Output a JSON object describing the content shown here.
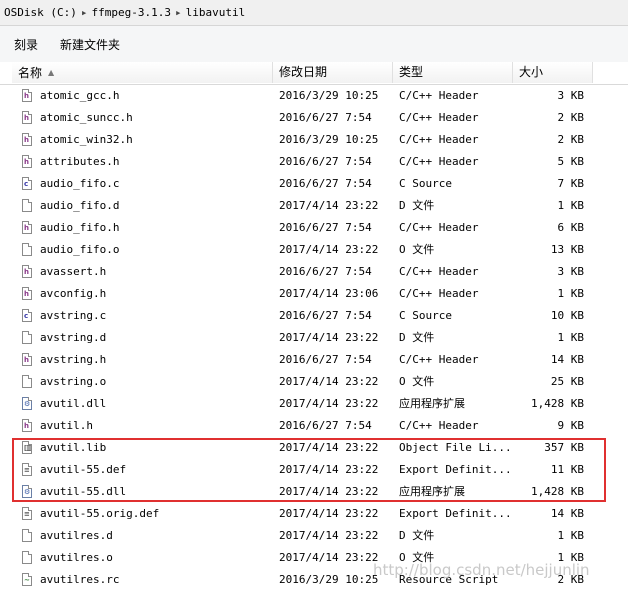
{
  "breadcrumb": [
    "OSDisk (C:)",
    "ffmpeg-3.1.3",
    "libavutil"
  ],
  "breadcrumb_separator": "▸",
  "toolbar": {
    "burn_label": "刻录",
    "new_folder_label": "新建文件夹"
  },
  "columns": {
    "name": "名称",
    "date": "修改日期",
    "type": "类型",
    "size": "大小"
  },
  "sort": {
    "column": "name",
    "direction": "ascending",
    "indicator": "▲"
  },
  "files": [
    {
      "name": "atomic_gcc.h",
      "date": "2016/3/29 10:25",
      "type": "C/C++ Header",
      "size": "3 KB",
      "icon": "h-header-icon",
      "glyph": "h",
      "kind": "h"
    },
    {
      "name": "atomic_suncc.h",
      "date": "2016/6/27 7:54",
      "type": "C/C++ Header",
      "size": "2 KB",
      "icon": "h-header-icon",
      "glyph": "h",
      "kind": "h"
    },
    {
      "name": "atomic_win32.h",
      "date": "2016/3/29 10:25",
      "type": "C/C++ Header",
      "size": "2 KB",
      "icon": "h-header-icon",
      "glyph": "h",
      "kind": "h"
    },
    {
      "name": "attributes.h",
      "date": "2016/6/27 7:54",
      "type": "C/C++ Header",
      "size": "5 KB",
      "icon": "h-header-icon",
      "glyph": "h",
      "kind": "h"
    },
    {
      "name": "audio_fifo.c",
      "date": "2016/6/27 7:54",
      "type": "C Source",
      "size": "7 KB",
      "icon": "c-source-icon",
      "glyph": "c",
      "kind": "c"
    },
    {
      "name": "audio_fifo.d",
      "date": "2017/4/14 23:22",
      "type": "D 文件",
      "size": "1 KB",
      "icon": "blank-file-icon",
      "glyph": "",
      "kind": "txt"
    },
    {
      "name": "audio_fifo.h",
      "date": "2016/6/27 7:54",
      "type": "C/C++ Header",
      "size": "6 KB",
      "icon": "h-header-icon",
      "glyph": "h",
      "kind": "h"
    },
    {
      "name": "audio_fifo.o",
      "date": "2017/4/14 23:22",
      "type": "O 文件",
      "size": "13 KB",
      "icon": "blank-file-icon",
      "glyph": "",
      "kind": "txt"
    },
    {
      "name": "avassert.h",
      "date": "2016/6/27 7:54",
      "type": "C/C++ Header",
      "size": "3 KB",
      "icon": "h-header-icon",
      "glyph": "h",
      "kind": "h"
    },
    {
      "name": "avconfig.h",
      "date": "2017/4/14 23:06",
      "type": "C/C++ Header",
      "size": "1 KB",
      "icon": "h-header-icon",
      "glyph": "h",
      "kind": "h"
    },
    {
      "name": "avstring.c",
      "date": "2016/6/27 7:54",
      "type": "C Source",
      "size": "10 KB",
      "icon": "c-source-icon",
      "glyph": "c",
      "kind": "c"
    },
    {
      "name": "avstring.d",
      "date": "2017/4/14 23:22",
      "type": "D 文件",
      "size": "1 KB",
      "icon": "blank-file-icon",
      "glyph": "",
      "kind": "txt"
    },
    {
      "name": "avstring.h",
      "date": "2016/6/27 7:54",
      "type": "C/C++ Header",
      "size": "14 KB",
      "icon": "h-header-icon",
      "glyph": "h",
      "kind": "h"
    },
    {
      "name": "avstring.o",
      "date": "2017/4/14 23:22",
      "type": "O 文件",
      "size": "25 KB",
      "icon": "blank-file-icon",
      "glyph": "",
      "kind": "txt"
    },
    {
      "name": "avutil.dll",
      "date": "2017/4/14 23:22",
      "type": "应用程序扩展",
      "size": "1,428 KB",
      "icon": "dll-gear-icon",
      "glyph": "⚙",
      "kind": "dll"
    },
    {
      "name": "avutil.h",
      "date": "2016/6/27 7:54",
      "type": "C/C++ Header",
      "size": "9 KB",
      "icon": "h-header-icon",
      "glyph": "h",
      "kind": "h"
    },
    {
      "name": "avutil.lib",
      "date": "2017/4/14 23:22",
      "type": "Object File Li...",
      "size": "357 KB",
      "icon": "lib-archive-icon",
      "glyph": "▥",
      "kind": "lib"
    },
    {
      "name": "avutil-55.def",
      "date": "2017/4/14 23:22",
      "type": "Export Definit...",
      "size": "11 KB",
      "icon": "text-file-icon",
      "glyph": "≡",
      "kind": "def"
    },
    {
      "name": "avutil-55.dll",
      "date": "2017/4/14 23:22",
      "type": "应用程序扩展",
      "size": "1,428 KB",
      "icon": "dll-gear-icon",
      "glyph": "⚙",
      "kind": "dll"
    },
    {
      "name": "avutil-55.orig.def",
      "date": "2017/4/14 23:22",
      "type": "Export Definit...",
      "size": "14 KB",
      "icon": "text-file-icon",
      "glyph": "≡",
      "kind": "def"
    },
    {
      "name": "avutilres.d",
      "date": "2017/4/14 23:22",
      "type": "D 文件",
      "size": "1 KB",
      "icon": "blank-file-icon",
      "glyph": "",
      "kind": "txt"
    },
    {
      "name": "avutilres.o",
      "date": "2017/4/14 23:22",
      "type": "O 文件",
      "size": "1 KB",
      "icon": "blank-file-icon",
      "glyph": "",
      "kind": "txt"
    },
    {
      "name": "avutilres.rc",
      "date": "2016/3/29 10:25",
      "type": "Resource Script",
      "size": "2 KB",
      "icon": "resource-script-icon",
      "glyph": "~",
      "kind": "rc"
    }
  ],
  "watermark": "http://blog.csdn.net/hejjunlin",
  "colors": {
    "highlight_border": "#e03030",
    "addressbar_bg": "#f0f0f0",
    "toolbar_bg": "#f5f6f7"
  }
}
